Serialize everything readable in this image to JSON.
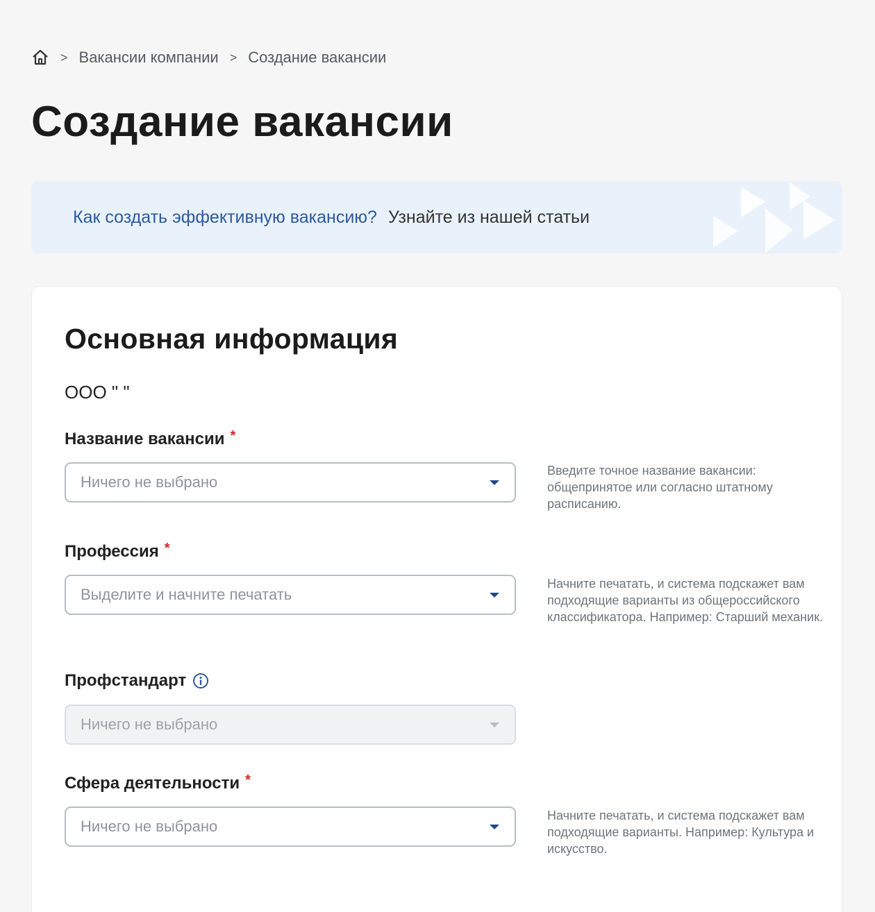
{
  "breadcrumb": {
    "home_icon": "home-icon",
    "separator": ">",
    "items": [
      "Вакансии компании",
      "Создание вакансии"
    ]
  },
  "page_title": "Создание вакансии",
  "banner": {
    "question": "Как создать эффективную вакансию?",
    "link": "Узнайте из нашей статьи",
    "bg_color": "#e9f1fb"
  },
  "section": {
    "title": "Основная информация",
    "company": "ООО \"                                   \""
  },
  "fields": {
    "vacancy_name": {
      "label": "Название вакансии",
      "required_mark": "*",
      "placeholder": "Ничего не выбрано",
      "hint": "Введите точное название вакансии: общепринятое или согласно штатному расписанию."
    },
    "profession": {
      "label": "Профессия",
      "required_mark": "*",
      "placeholder": "Выделите и начните печатать",
      "hint": "Начните печатать, и система подскажет вам подходящие варианты из общероссийского классификатора. Например: Старший механик."
    },
    "prof_standard": {
      "label": "Профстандарт",
      "info_icon": "info-icon",
      "placeholder": "Ничего не выбрано",
      "disabled": true
    },
    "activity_sphere": {
      "label": "Сфера деятельности",
      "required_mark": "*",
      "placeholder": "Ничего не выбрано",
      "hint": "Начните печатать, и система подскажет вам подходящие варианты. Например: Культура и искусство."
    }
  },
  "colors": {
    "accent": "#2c5aa0",
    "required": "#e0212a",
    "caret": "#1f4a8c"
  }
}
